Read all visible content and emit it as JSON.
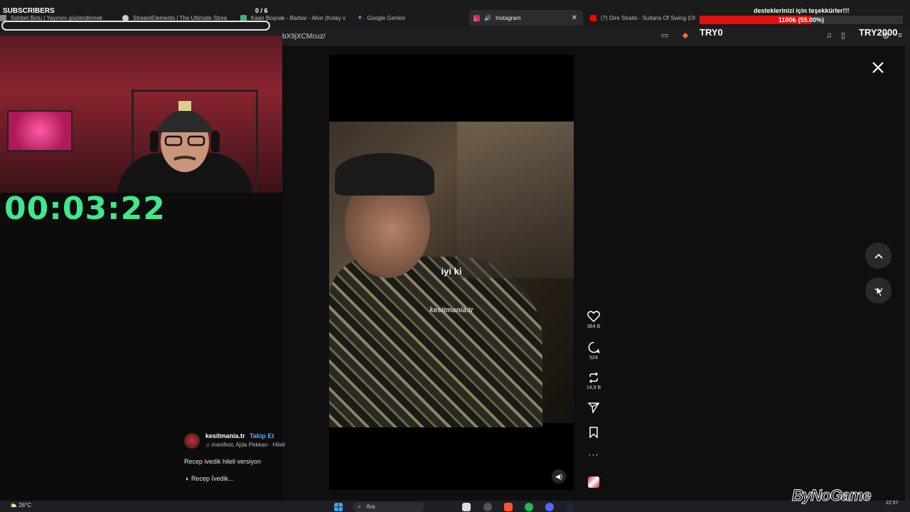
{
  "tabs": [
    {
      "label": "Sohbet Botu | Yayınını güçlendirmek",
      "color": "#888888"
    },
    {
      "label": "StreamElements | The Ultimate Strea",
      "color": "#cccccc"
    },
    {
      "label": "Kaan Boşnak - Barbar - Akor (Kolay v",
      "color": "#3cb371"
    },
    {
      "label": "Google Gemini",
      "color": "#6a8cff"
    },
    {
      "label": "Instagram",
      "color": "#e1306c"
    },
    {
      "label": "(7) Dire Straits - Sultans Of Swing (Ol",
      "color": "#ff0000"
    }
  ],
  "url": "bX9jXCMcuz/",
  "overlay": {
    "subscribers_label": "SUBSCRIBERS",
    "subscribers_count": "0 / 6",
    "donation_message": "desteklerinizi için teşekkürler!!!",
    "donation_progress_text": "1100₺ (55.00%)",
    "donation_progress": 55,
    "donation_min": "TRY0",
    "donation_max": "TRY2000",
    "timer": "00:03:22"
  },
  "video": {
    "subtitle": "iyi ki",
    "watermark": "kesitmania.tr"
  },
  "actions": {
    "likes": "364 B",
    "comments": "524",
    "reposts": "14,9 B"
  },
  "post": {
    "username": "kesitmania.tr",
    "follow_label": "Takip Et",
    "music": "manifest, Ajda Pekkan · Hileli",
    "caption": "Recep ivedik hileli versiyon",
    "effect": "Recep İvedik..."
  },
  "taskbar": {
    "temperature": "26°C",
    "search_placeholder": "Ara",
    "time": "22:57"
  },
  "brand_watermark": "ByNoGame"
}
